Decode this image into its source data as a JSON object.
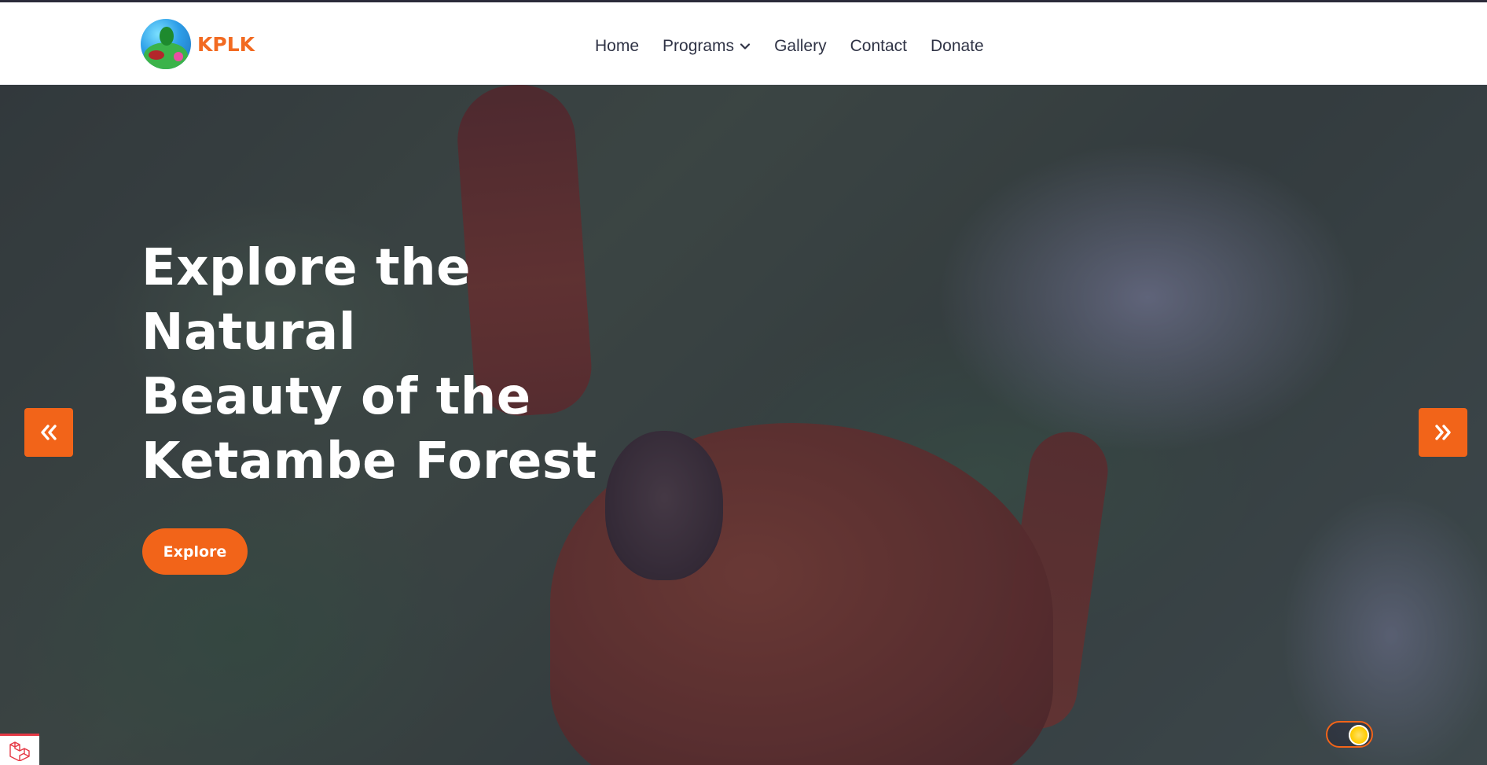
{
  "brand": {
    "name": "KPLK",
    "logo_icon": "kplk-logo-icon"
  },
  "nav": {
    "items": [
      {
        "label": "Home"
      },
      {
        "label": "Programs",
        "icon": "chevron-down-icon"
      },
      {
        "label": "Gallery"
      },
      {
        "label": "Contact"
      },
      {
        "label": "Donate"
      }
    ]
  },
  "hero": {
    "title_lines": [
      "Explore the Natural",
      "Beauty of the",
      "Ketambe Forest"
    ],
    "button_label": "Explore",
    "prev_icon": "double-chevron-left-icon",
    "next_icon": "double-chevron-right-icon"
  },
  "theme_toggle": {
    "icon": "sun-icon",
    "state": "on"
  },
  "corner_badge": {
    "icon": "laravel-icon"
  },
  "colors": {
    "accent": "#f26419",
    "brand": "#f26a21",
    "nav_text": "#2f3345",
    "hero_text": "#ffffff"
  }
}
